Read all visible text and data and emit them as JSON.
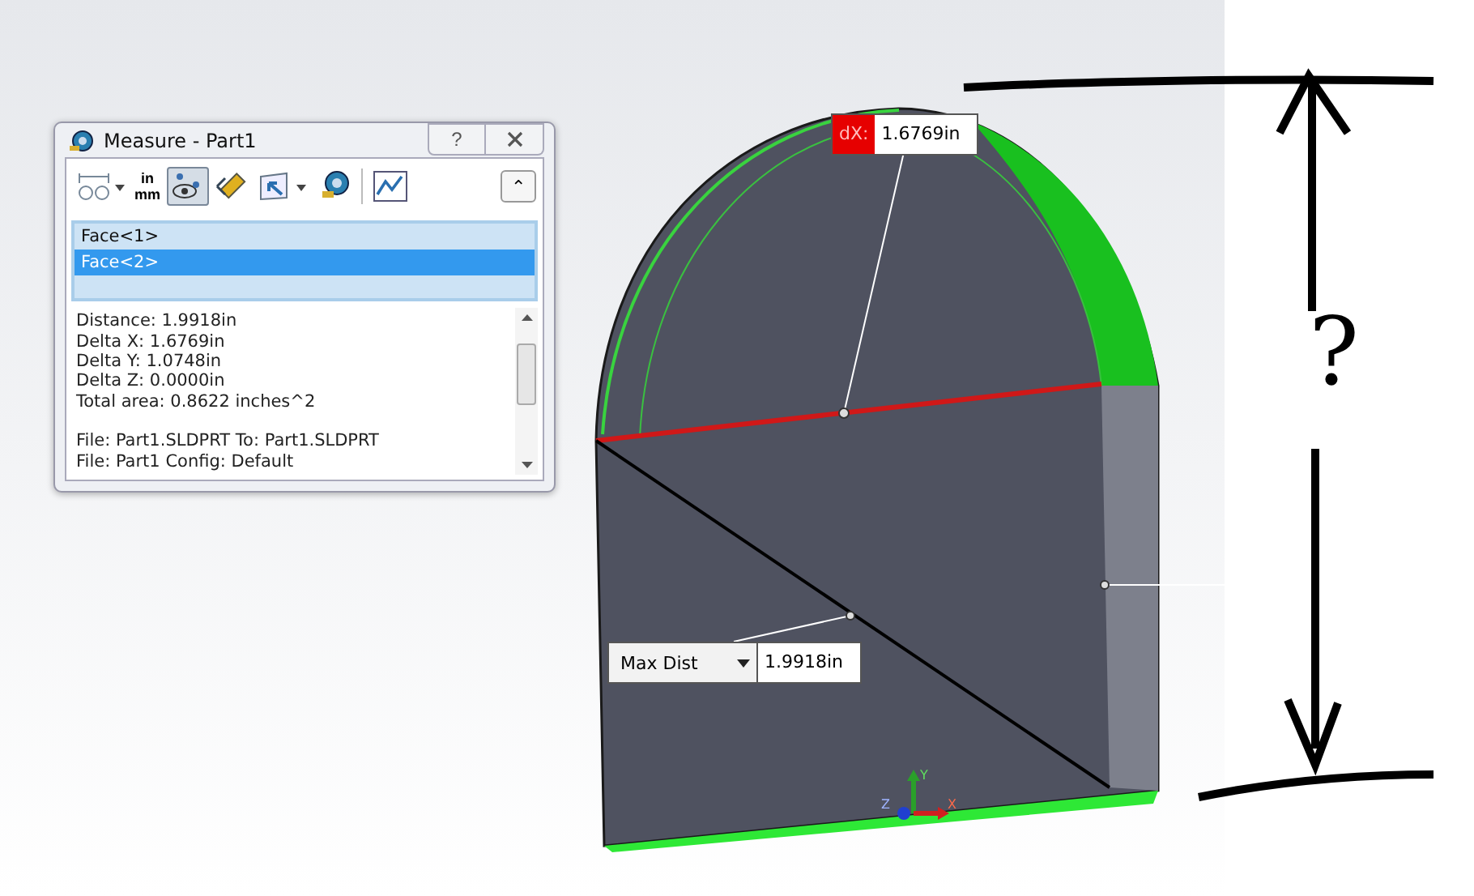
{
  "window": {
    "title": "Measure - Part1",
    "help_button": "?"
  },
  "toolbar": {
    "units_top": "in",
    "units_bottom": "mm",
    "xyz_pressed": true,
    "collapse_button": "⌃"
  },
  "selections": [
    {
      "label": "Face<1>",
      "selected": false
    },
    {
      "label": "Face<2>",
      "selected": true
    }
  ],
  "results": [
    [
      "Distance: 1.9918in",
      "Delta X: 1.6769in",
      "Delta Y: 1.0748in",
      "Delta Z: 0.0000in",
      "Total area: 0.8622 inches^2"
    ],
    [
      "File: Part1.SLDPRT To: Part1.SLDPRT",
      "File: Part1 Config: Default"
    ]
  ],
  "viewport": {
    "dx_callout": {
      "label": "dX:",
      "value": "1.6769in"
    },
    "max_dist_callout": {
      "option": "Max Dist",
      "value": "1.9918in"
    },
    "triad": {
      "x": "X",
      "y": "Y",
      "z": "Z"
    },
    "annotation": {
      "mark": "?"
    }
  }
}
